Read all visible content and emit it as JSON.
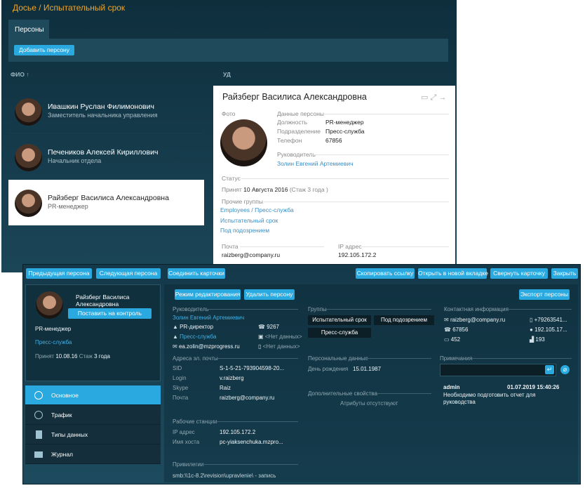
{
  "back": {
    "title": "Досье / Испытательный срок",
    "tab": "Персоны",
    "add_button": "Добавить персону",
    "col_fio": "ФИО ↑",
    "col_ud": "УД",
    "persons": [
      {
        "name": "Ивашкин Руслан Филимонович",
        "role": "Заместитель начальника управления"
      },
      {
        "name": "Печеников Алексей Кириллович",
        "role": "Начальник отдела"
      },
      {
        "name": "Райзберг Василиса Александровна",
        "role": "PR-менеджер"
      }
    ]
  },
  "card": {
    "name": "Райзберг Василиса Александровна",
    "photo_label": "Фото",
    "data_label": "Данные персоны",
    "position_label": "Должность",
    "position": "PR-менеджер",
    "dept_label": "Подразделение",
    "dept": "Пресс-служба",
    "phone_label": "Телефон",
    "phone": "67856",
    "manager_label": "Руководитель",
    "manager": "Золин Евгений Артемиевич",
    "status_label": "Статус",
    "hired_label": "Принят",
    "hired": "10 Августа 2016",
    "tenure": "(Стаж 3 года )",
    "groups_label": "Прочие группы",
    "groups": [
      "Employees / Пресс-служба",
      "Испытательный срок",
      "Под подозрением"
    ],
    "mail_label": "Почта",
    "mail": "raizberg@company.ru",
    "ip_label": "IP адрес",
    "ip": "192.105.172.2"
  },
  "front": {
    "toolbar": {
      "prev": "Предыдущая персона",
      "next": "Следующая персона",
      "link": "Соединить карточки",
      "copy": "Скопировать ссылку",
      "open": "Открыть в новой вкладке",
      "collapse": "Свернуть карточку",
      "close": "Закрыть"
    },
    "profile": {
      "name": "Райзберг Василиса Александровна",
      "control_button": "Поставить на контроль",
      "role": "PR-менеджер",
      "dept": "Пресс-служба",
      "hired_label": "Принят",
      "hired": "10.08.16",
      "tenure_label": "Стаж",
      "tenure": "3 года"
    },
    "nav": [
      "Основное",
      "Трафик",
      "Типы данных",
      "Журнал"
    ],
    "edit_button": "Режим редактирования",
    "delete_button": "Удалить персону",
    "export_button": "Экспорт персоны",
    "manager_section": "Руководитель",
    "manager_name": "Золин Евгений Артемиевич",
    "manager_role": "PR-директор",
    "manager_dept": "Пресс-служба",
    "manager_email": "ea.zolin@mzprogress.ru",
    "manager_phone": "9267",
    "no_data_1": "<Нет данных>",
    "no_data_2": "<Нет данных>",
    "groups_section": "Группы",
    "groups": [
      "Испытательный срок",
      "Под подозрением",
      "Пресс-служба"
    ],
    "contact_section": "Контактная информация",
    "contact": {
      "email": "raizberg@company.ru",
      "mobile": "+79263541...",
      "phone": "67856",
      "ip": "192.105.17...",
      "room": "452",
      "building": "193"
    },
    "mail_section": "Адреса эл. почты",
    "sid_label": "SID",
    "sid": "S-1-5-21-793904598-20...",
    "login_label": "Login",
    "login": "v.raizberg",
    "skype_label": "Skype",
    "skype": "Raiz",
    "mail_label": "Почта",
    "mail": "raizberg@company.ru",
    "personal_section": "Персональные данные",
    "birth_label": "День рождения",
    "birth": "15.01.1987",
    "extra_section": "Дополнительные свойства",
    "no_attrs": "Атрибуты отсутствуют",
    "notes_section": "Примечания",
    "note_author": "admin",
    "note_date": "01.07.2019 15:40:26",
    "note_text": "Необходимо подготовить отчет для руководства",
    "ws_section": "Рабочие станции",
    "ip_label": "IP адрес",
    "ip": "192.105.172.2",
    "host_label": "Имя хоста",
    "host": "pc-yiaksenchuka.mzpro...",
    "priv_section": "Привилегии",
    "priv": "smb:\\\\1c-8.2\\revision\\upravlenie\\ - запись"
  }
}
